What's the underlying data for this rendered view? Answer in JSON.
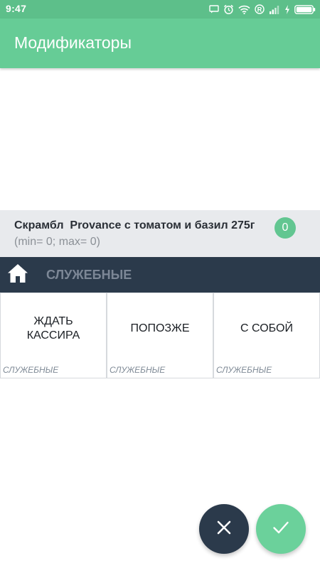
{
  "status_bar": {
    "time": "9:47",
    "icons": [
      "message-icon",
      "alarm-icon",
      "wifi-icon",
      "registered-icon",
      "signal-icon",
      "charging-icon",
      "battery-icon"
    ]
  },
  "app_bar": {
    "title": "Модификаторы"
  },
  "item": {
    "name": "Скрамбл  Provance с томатом и базил 275г",
    "range": "(min= 0; max= 0)",
    "count": "0"
  },
  "category_bar": {
    "home_icon": "home-icon",
    "title": "СЛУЖЕБНЫЕ"
  },
  "modifiers": [
    {
      "label": "ЖДАТЬ КАССИРА",
      "category": "СЛУЖЕБНЫЕ"
    },
    {
      "label": "ПОПОЗЖЕ",
      "category": "СЛУЖЕБНЫЕ"
    },
    {
      "label": "С СОБОЙ",
      "category": "СЛУЖЕБНЫЕ"
    }
  ],
  "actions": {
    "cancel_icon": "close-icon",
    "confirm_icon": "check-icon"
  },
  "colors": {
    "status_bar": "#5dbf8a",
    "app_bar": "#66cc96",
    "accent": "#62c691",
    "dark": "#2b3a4b",
    "panel": "#e8eaed"
  }
}
